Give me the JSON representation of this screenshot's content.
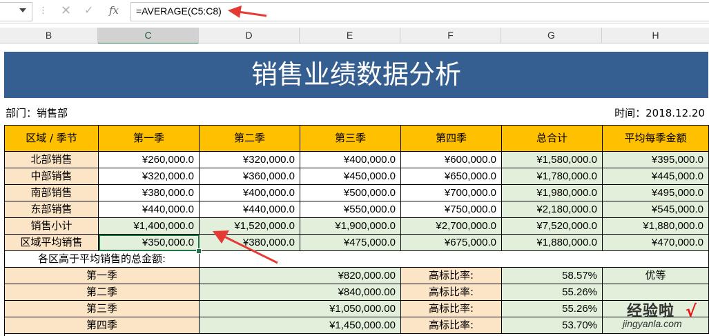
{
  "formula_bar": {
    "formula": "=AVERAGE(C5:C8)",
    "fx_label": "fx"
  },
  "columns": [
    "B",
    "C",
    "D",
    "E",
    "F",
    "G",
    "H"
  ],
  "sheet": {
    "title": "销售业绩数据分析",
    "department": "部门：销售部",
    "time": "时间：2018.12.20",
    "headers": [
      "区域 / 季节",
      "第一季",
      "第二季",
      "第三季",
      "第四季",
      "总合计",
      "平均每季金额"
    ],
    "rows": [
      [
        "北部销售",
        "¥260,000.0",
        "¥320,000.0",
        "¥400,000.0",
        "¥600,000.0",
        "¥1,580,000.0",
        "¥395,000.0"
      ],
      [
        "中部销售",
        "¥320,000.0",
        "¥360,000.0",
        "¥450,000.0",
        "¥650,000.0",
        "¥1,780,000.0",
        "¥445,000.0"
      ],
      [
        "南部销售",
        "¥380,000.0",
        "¥400,000.0",
        "¥500,000.0",
        "¥700,000.0",
        "¥1,980,000.0",
        "¥495,000.0"
      ],
      [
        "东部销售",
        "¥440,000.0",
        "¥440,000.0",
        "¥550,000.0",
        "¥750,000.0",
        "¥2,180,000.0",
        "¥545,000.0"
      ],
      [
        "销售小计",
        "¥1,400,000.0",
        "¥1,520,000.0",
        "¥1,900,000.0",
        "¥2,700,000.0",
        "¥7,520,000.0",
        "¥1,880,000.0"
      ],
      [
        "区域平均销售",
        "¥350,000.0",
        "¥380,000.0",
        "¥475,000.0",
        "¥675,000.0",
        "¥1,880,000.0",
        "¥470,000.0"
      ]
    ],
    "above_avg_label": "各区高于平均销售的总金额:",
    "quarter_rows": [
      {
        "season": "第一季",
        "amount": "¥820,000.00",
        "ratio_label": "高标比率:",
        "ratio": "58.57%",
        "grade": "优等"
      },
      {
        "season": "第二季",
        "amount": "¥840,000.00",
        "ratio_label": "高标比率:",
        "ratio": "55.26%",
        "grade": ""
      },
      {
        "season": "第三季",
        "amount": "¥1,050,000.00",
        "ratio_label": "高标比率:",
        "ratio": "55.26%",
        "grade": ""
      },
      {
        "season": "第四季",
        "amount": "¥1,450,000.00",
        "ratio_label": "高标比率:",
        "ratio": "53.70%",
        "grade": ""
      }
    ]
  },
  "watermark": {
    "text": "经验啦",
    "url": "jingyanla.com",
    "check": "√"
  },
  "colors": {
    "title_bg": "#365f91",
    "header_bg": "#ffc000",
    "label_bg": "#fce4c6",
    "calc_bg": "#e2efda",
    "selection": "#217346",
    "arrow": "#e53935"
  }
}
